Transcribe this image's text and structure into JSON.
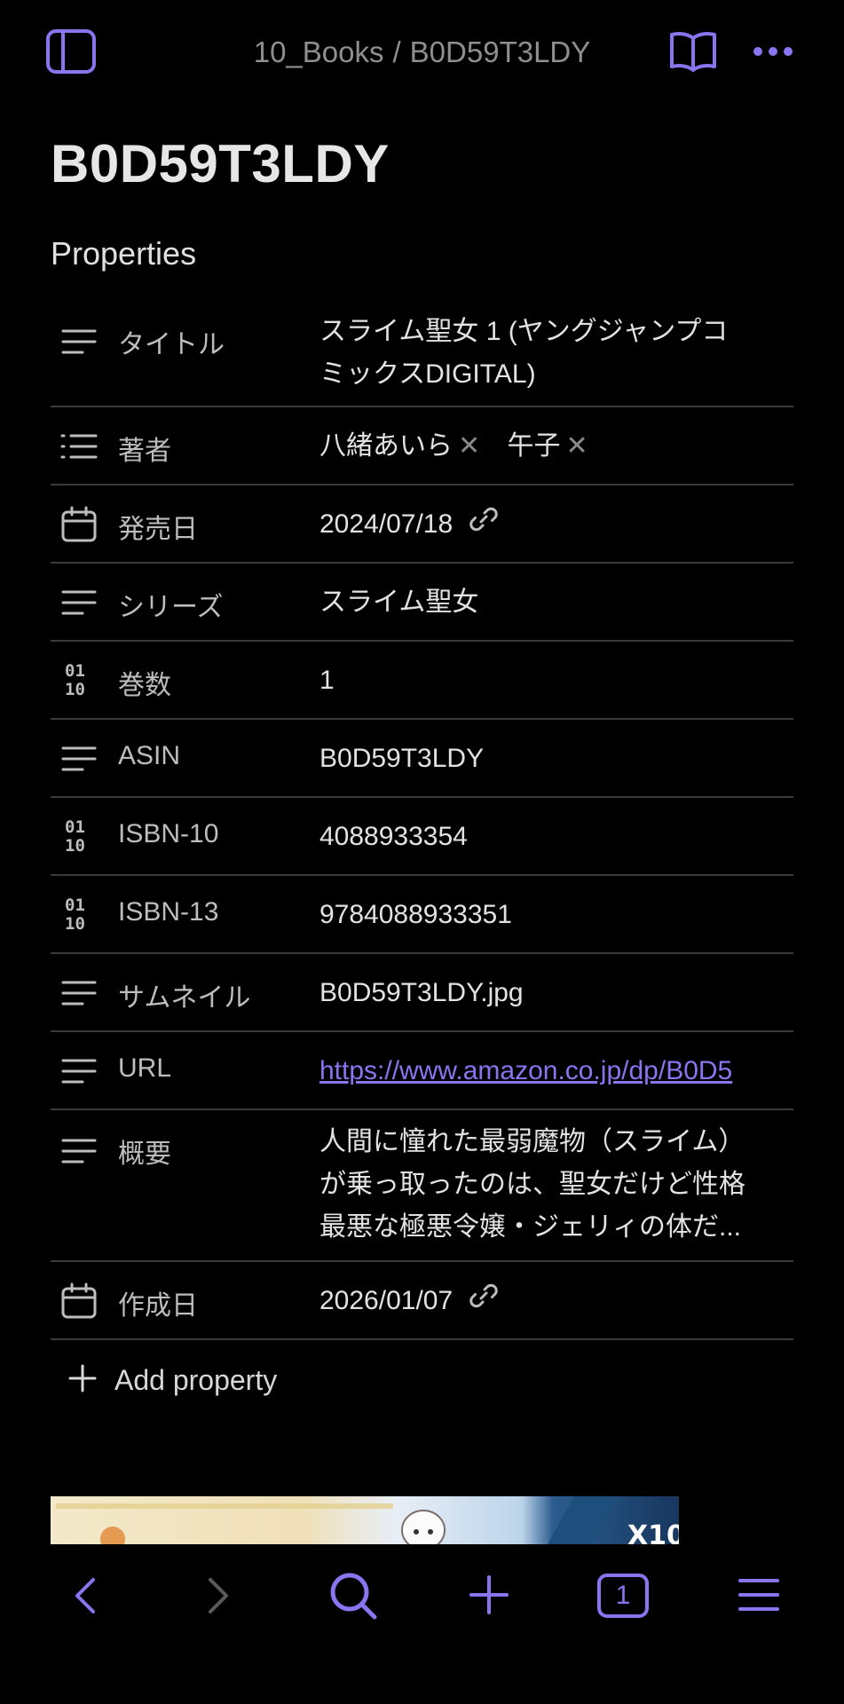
{
  "topbar": {
    "breadcrumb_folder": "10_Books",
    "breadcrumb_separator": "/",
    "breadcrumb_file": "B0D59T3LDY"
  },
  "page_title": "B0D59T3LDY",
  "properties_heading": "Properties",
  "properties": [
    {
      "icon": "text-icon",
      "label": "タイトル",
      "value_line1": "スライム聖女 1 (ヤングジャンプコ",
      "value_line2": "ミックスDIGITAL)"
    },
    {
      "icon": "list-icon",
      "label": "著者",
      "chips": [
        "八緒あいら",
        "午子"
      ]
    },
    {
      "icon": "calendar-icon",
      "label": "発売日",
      "value": "2024/07/18"
    },
    {
      "icon": "text-icon",
      "label": "シリーズ",
      "value": "スライム聖女"
    },
    {
      "icon": "number-icon",
      "label": "巻数",
      "value": "1"
    },
    {
      "icon": "text-icon",
      "label": "ASIN",
      "value": "B0D59T3LDY"
    },
    {
      "icon": "number-icon",
      "label": "ISBN-10",
      "value": "4088933354"
    },
    {
      "icon": "number-icon",
      "label": "ISBN-13",
      "value": "9784088933351"
    },
    {
      "icon": "text-icon",
      "label": "サムネイル",
      "value": "B0D59T3LDY.jpg"
    },
    {
      "icon": "text-icon",
      "label": "URL",
      "value": "https://www.amazon.co.jp/dp/B0D5"
    },
    {
      "icon": "text-icon",
      "label": "概要",
      "value_line1": "人間に憧れた最弱魔物（スライム）",
      "value_line2": "が乗っ取ったのは、聖女だけど性格",
      "value_line3": "最悪な極悪令嬢・ジェリィの体だ..."
    },
    {
      "icon": "calendar-icon",
      "label": "作成日",
      "value": "2026/01/07"
    }
  ],
  "add_property_label": "Add property",
  "bottombar": {
    "tab_count": "1"
  },
  "colors": {
    "accent": "#8b74f0",
    "background": "#000000",
    "divider": "#3a3a3a"
  }
}
